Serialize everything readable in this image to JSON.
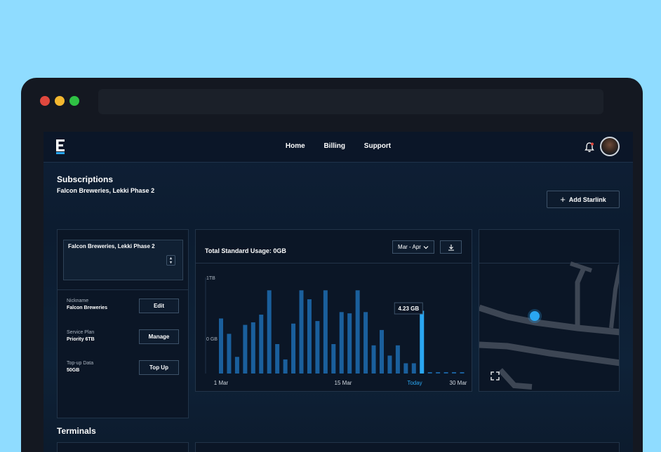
{
  "window": {
    "dots": [
      "#e0483e",
      "#f3b72f",
      "#2fc144"
    ]
  },
  "nav": {
    "links": [
      "Home",
      "Billing",
      "Support"
    ]
  },
  "header": {
    "title": "Subscriptions",
    "subtitle": "Falcon Breweries, Lekki Phase 2",
    "add_button": "Add Starlink"
  },
  "left_panel": {
    "selected_site": "Falcon Breweries, Lekki Phase 2",
    "rows": [
      {
        "label": "Nickname",
        "value": "Falcon Breweries",
        "button": "Edit"
      },
      {
        "label": "Service Plan",
        "value": "Priority 6TB",
        "button": "Manage"
      },
      {
        "label": "Top-up Data",
        "value": "50GB",
        "button": "Top Up"
      }
    ]
  },
  "usage": {
    "title": "Total Standard Usage: 0GB",
    "range": "Mar - Apr",
    "tooltip": "4.23 GB"
  },
  "chart_data": {
    "type": "bar",
    "title": "Total Standard Usage: 0GB",
    "ytick_labels": [
      "1TB",
      "0 GB"
    ],
    "xtick_labels": [
      "1 Mar",
      "15 Mar",
      "Today",
      "30 Mar"
    ],
    "highlight_label": "4.23 GB",
    "highlight_index": 25,
    "colors": {
      "bar": "#1a5f9c",
      "highlight": "#2aa7f2",
      "future": "#1a5f9c"
    },
    "values": [
      0.43,
      0.31,
      0.13,
      0.38,
      0.4,
      0.46,
      0.65,
      0.23,
      0.11,
      0.39,
      0.65,
      0.58,
      0.41,
      0.65,
      0.23,
      0.48,
      0.47,
      0.65,
      0.48,
      0.22,
      0.34,
      0.14,
      0.22,
      0.08,
      0.08,
      0.49,
      0.01,
      0.01,
      0.01,
      0.01,
      0.01
    ]
  },
  "terminals": {
    "title": "Terminals"
  }
}
